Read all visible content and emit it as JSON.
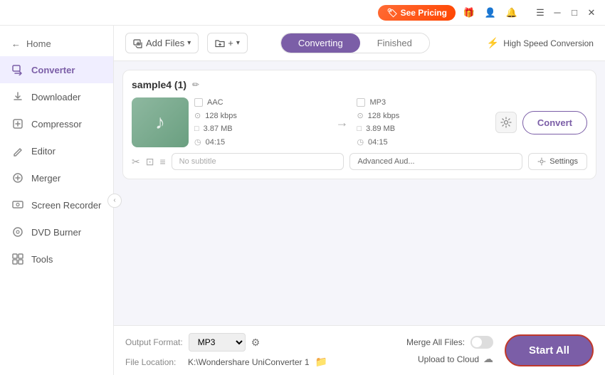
{
  "titlebar": {
    "pricing_label": "See Pricing",
    "gift_icon": "🎁",
    "profile_icon": "👤",
    "bell_icon": "🔔",
    "menu_icon": "☰",
    "minimize_icon": "─",
    "maximize_icon": "□",
    "close_icon": "✕"
  },
  "sidebar": {
    "home_label": "Home",
    "items": [
      {
        "id": "converter",
        "label": "Converter",
        "icon": "⇄",
        "active": true
      },
      {
        "id": "downloader",
        "label": "Downloader",
        "icon": "↓"
      },
      {
        "id": "compressor",
        "label": "Compressor",
        "icon": "⊡"
      },
      {
        "id": "editor",
        "label": "Editor",
        "icon": "✂"
      },
      {
        "id": "merger",
        "label": "Merger",
        "icon": "⊕"
      },
      {
        "id": "screen-recorder",
        "label": "Screen Recorder",
        "icon": "⊙"
      },
      {
        "id": "dvd-burner",
        "label": "DVD Burner",
        "icon": "⊚"
      },
      {
        "id": "tools",
        "label": "Tools",
        "icon": "⊞"
      }
    ]
  },
  "toolbar": {
    "add_file_label": "Add Files",
    "add_folder_label": "Add Folder",
    "tab_converting": "Converting",
    "tab_finished": "Finished",
    "high_speed_label": "High Speed Conversion"
  },
  "file": {
    "title": "sample4 (1)",
    "source": {
      "format": "AAC",
      "bitrate": "128 kbps",
      "size": "3.87 MB",
      "duration": "04:15"
    },
    "target": {
      "format": "MP3",
      "bitrate": "128 kbps",
      "size": "3.89 MB",
      "duration": "04:15"
    },
    "subtitle_placeholder": "No subtitle",
    "advanced_audio": "Advanced Aud...",
    "settings_label": "Settings",
    "convert_label": "Convert"
  },
  "bottom": {
    "output_format_label": "Output Format:",
    "output_format_value": "MP3",
    "file_location_label": "File Location:",
    "file_location_value": "K:\\Wondershare UniConverter 1",
    "merge_files_label": "Merge All Files:",
    "upload_cloud_label": "Upload to Cloud",
    "start_all_label": "Start All"
  }
}
